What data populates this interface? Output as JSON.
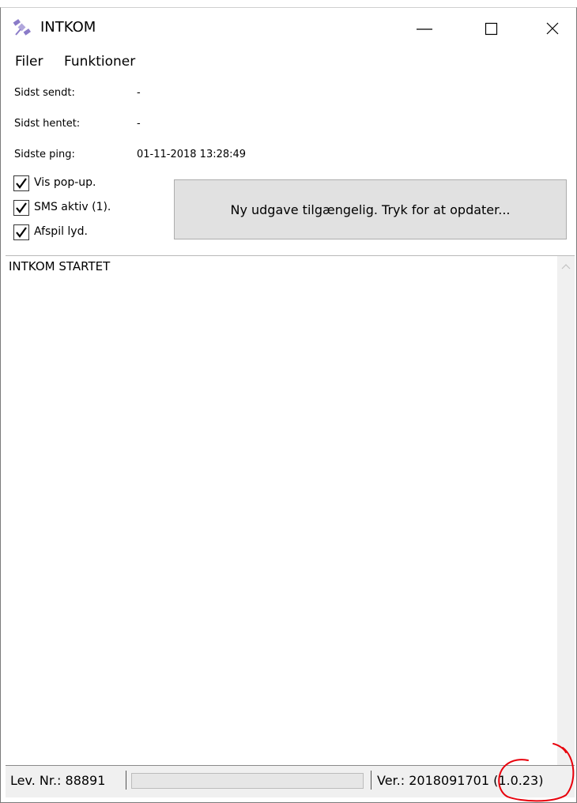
{
  "window": {
    "title": "INTKOM",
    "icon": "satellite-icon"
  },
  "menu": {
    "items": [
      "Filer",
      "Funktioner"
    ]
  },
  "info": {
    "rows": [
      {
        "label": "Sidst sendt:",
        "value": "-"
      },
      {
        "label": "Sidst hentet:",
        "value": "-"
      },
      {
        "label": "Sidste ping:",
        "value": "01-11-2018 13:28:49"
      }
    ]
  },
  "options": {
    "checkboxes": [
      {
        "label": "Vis pop-up.",
        "checked": true
      },
      {
        "label": "SMS aktiv (1).",
        "checked": true
      },
      {
        "label": "Afspil lyd.",
        "checked": true
      }
    ]
  },
  "update_button": {
    "label": "Ny udgave tilgængelig. Tryk for at opdater..."
  },
  "log": {
    "text": "INTKOM STARTET"
  },
  "status": {
    "lev": "Lev. Nr.: 88891",
    "ver": "Ver.: 2018091701 (1.0.23)"
  },
  "colors": {
    "annotation": "#e8000b",
    "button_bg": "#e1e1e1",
    "status_bg": "#f0f0f0"
  }
}
